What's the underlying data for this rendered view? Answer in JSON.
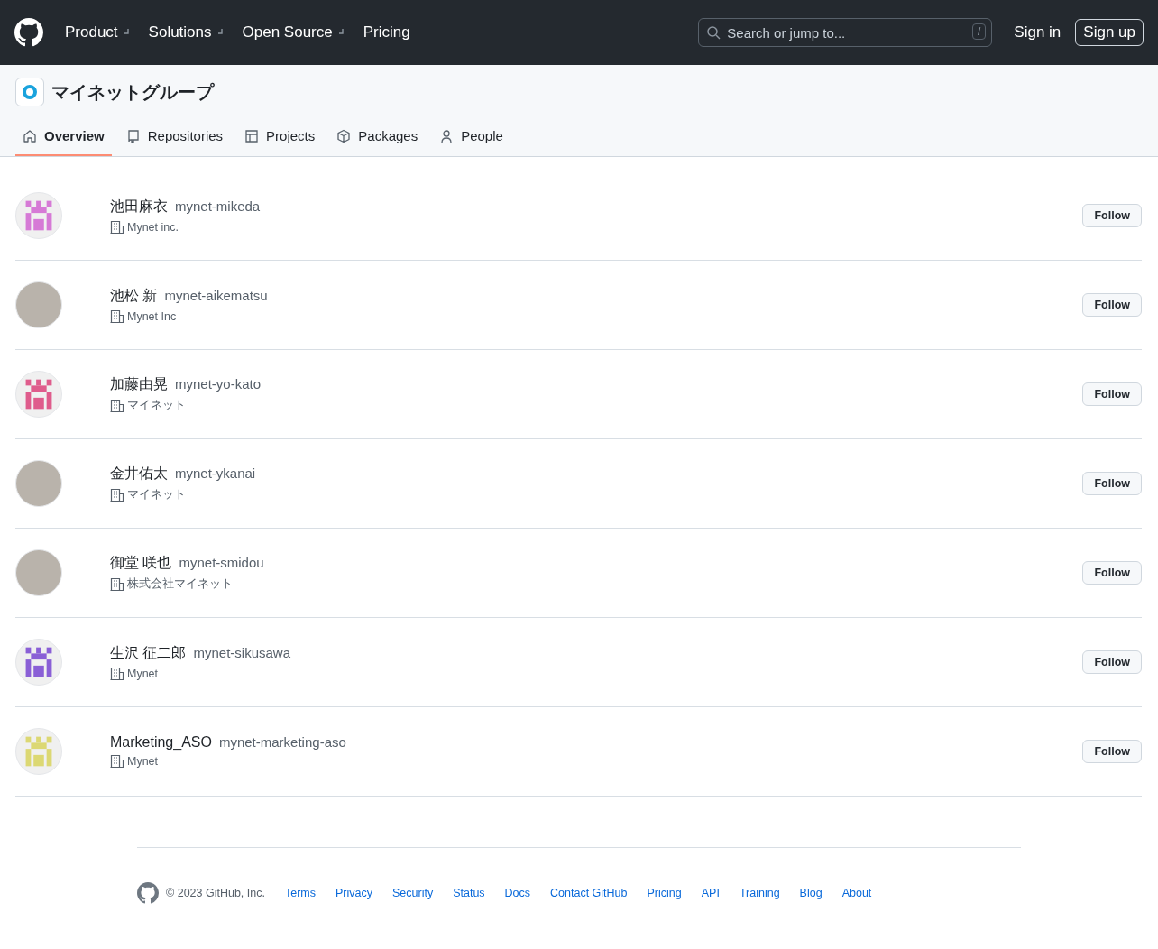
{
  "top_nav": {
    "items": [
      {
        "label": "Product",
        "dropdown": true
      },
      {
        "label": "Solutions",
        "dropdown": true
      },
      {
        "label": "Open Source",
        "dropdown": true
      },
      {
        "label": "Pricing",
        "dropdown": false
      }
    ],
    "search": {
      "placeholder": "Search or jump to...",
      "shortcut": "/"
    },
    "sign_in": "Sign in",
    "sign_up": "Sign up"
  },
  "org": {
    "name": "マイネットグループ"
  },
  "tabs": [
    {
      "label": "Overview",
      "selected": true
    },
    {
      "label": "Repositories",
      "selected": false
    },
    {
      "label": "Projects",
      "selected": false
    },
    {
      "label": "Packages",
      "selected": false
    },
    {
      "label": "People",
      "selected": false
    }
  ],
  "members": [
    {
      "name": "池田麻衣",
      "login": "mynet-mikeda",
      "company": "Mynet inc.",
      "avatar": {
        "kind": "identicon",
        "color": "#d67ad6"
      },
      "button": "Follow"
    },
    {
      "name": "池松 新",
      "login": "mynet-aikematsu",
      "company": "Mynet Inc",
      "avatar": {
        "kind": "photo"
      },
      "button": "Follow"
    },
    {
      "name": "加藤由晃",
      "login": "mynet-yo-kato",
      "company": "マイネット",
      "avatar": {
        "kind": "identicon",
        "color": "#df5c8c"
      },
      "button": "Follow"
    },
    {
      "name": "金井佑太",
      "login": "mynet-ykanai",
      "company": "マイネット",
      "avatar": {
        "kind": "photo"
      },
      "button": "Follow"
    },
    {
      "name": "御堂 咲也",
      "login": "mynet-smidou",
      "company": "株式会社マイネット",
      "avatar": {
        "kind": "photo"
      },
      "button": "Follow"
    },
    {
      "name": "生沢 征二郎",
      "login": "mynet-sikusawa",
      "company": "Mynet",
      "avatar": {
        "kind": "identicon",
        "color": "#8a5fd6"
      },
      "button": "Follow"
    },
    {
      "name": "Marketing_ASO",
      "login": "mynet-marketing-aso",
      "company": "Mynet",
      "avatar": {
        "kind": "identicon",
        "color": "#dcd873"
      },
      "button": "Follow"
    }
  ],
  "footer": {
    "copyright": "© 2023 GitHub, Inc.",
    "links": [
      "Terms",
      "Privacy",
      "Security",
      "Status",
      "Docs",
      "Contact GitHub",
      "Pricing",
      "API",
      "Training",
      "Blog",
      "About"
    ]
  }
}
